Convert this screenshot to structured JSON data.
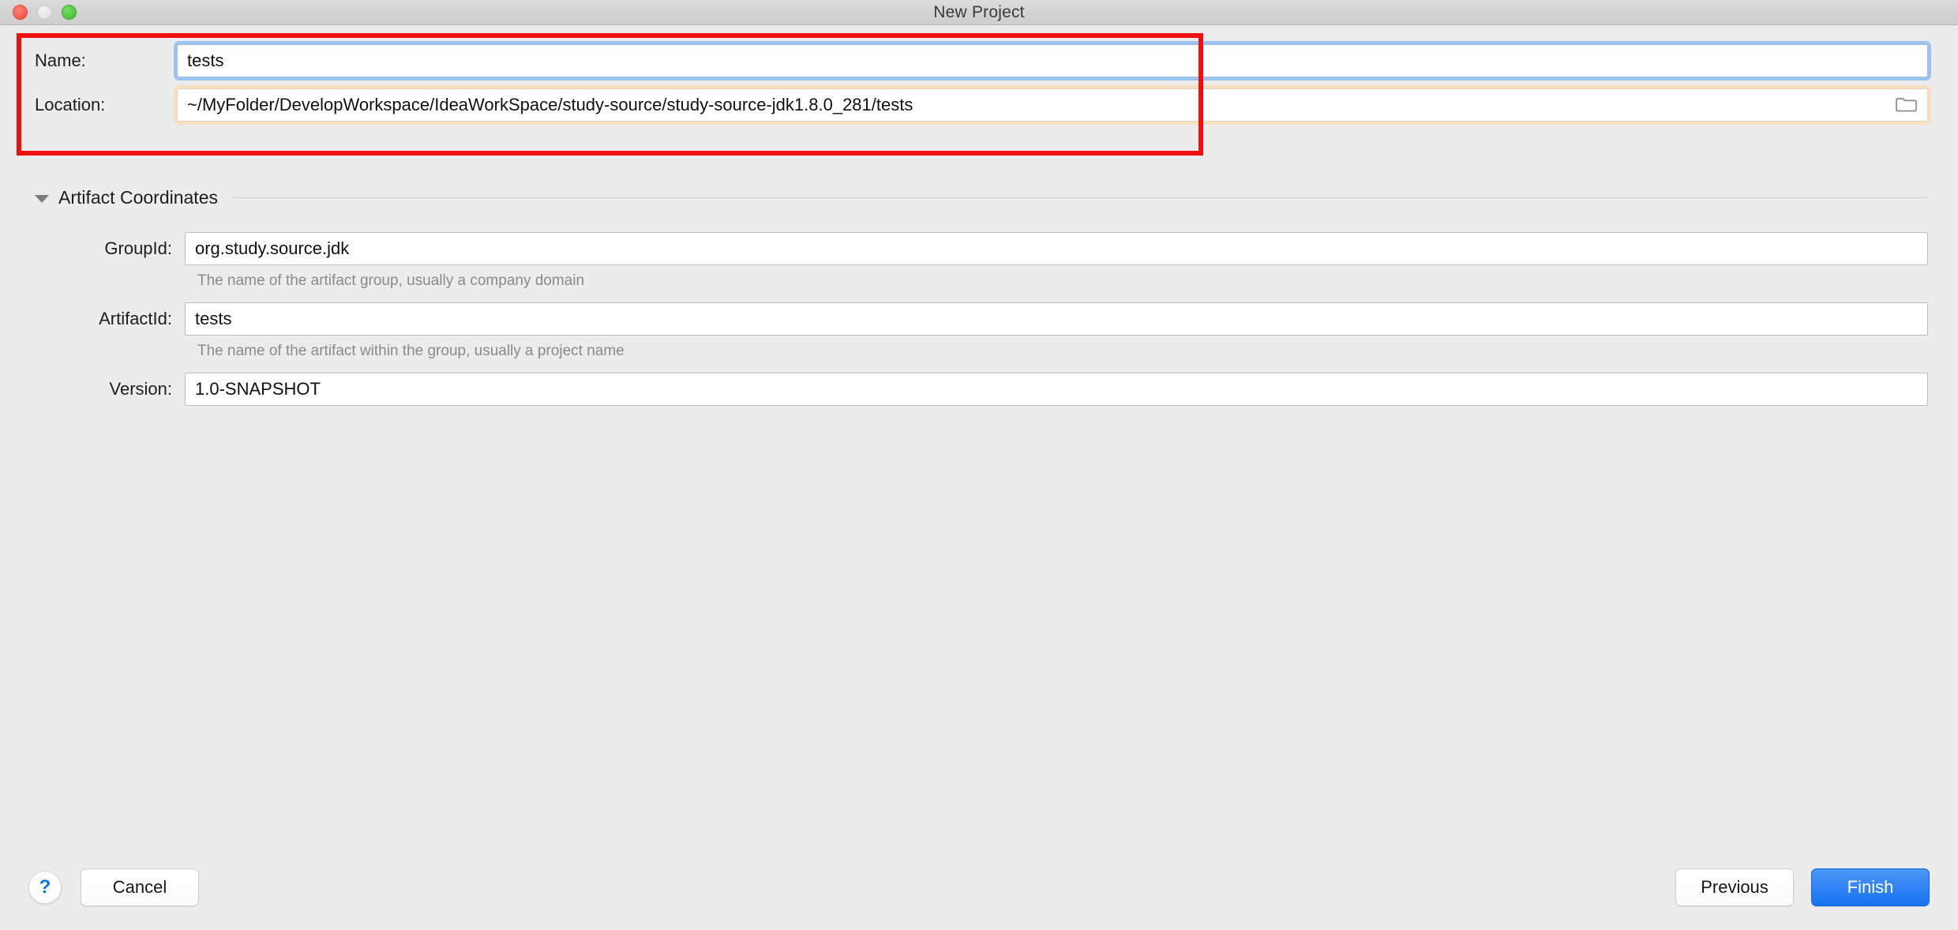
{
  "window": {
    "title": "New Project",
    "traffic_lights": [
      {
        "name": "close-button",
        "color": "#f0594c"
      },
      {
        "name": "minimize-button",
        "color": "#e3e3e3"
      },
      {
        "name": "zoom-button",
        "color": "#4cc63c"
      }
    ]
  },
  "top_fields": {
    "name": {
      "label": "Name:",
      "value": "tests",
      "placeholder": "Project name"
    },
    "location": {
      "label": "Location:",
      "value": "~/MyFolder/DevelopWorkspace/IdeaWorkSpace/study-source/study-source-jdk1.8.0_281/tests",
      "placeholder": "Project location",
      "browse_icon": "folder-icon"
    }
  },
  "section": {
    "title": "Artifact Coordinates",
    "expanded": true,
    "disclosure_icon": "triangle-down-icon"
  },
  "coordinates": [
    {
      "label": "GroupId:",
      "value": "org.study.source.jdk",
      "hint": "The name of the artifact group, usually a company domain",
      "field_name": "groupid"
    },
    {
      "label": "ArtifactId:",
      "value": "tests",
      "hint": "The name of the artifact within the group, usually a project name",
      "field_name": "artifactid"
    },
    {
      "label": "Version:",
      "value": "1.0-SNAPSHOT",
      "hint": "",
      "field_name": "version"
    }
  ],
  "footer": {
    "help_label": "?",
    "cancel_label": "Cancel",
    "previous_label": "Previous",
    "finish_label": "Finish"
  },
  "colors": {
    "accent": "#1672ef",
    "annotation": "#ef0f0f",
    "focus_ring": "#9cc4f0",
    "warn_ring": "#f7e0c2",
    "window_bg": "#ececec"
  }
}
